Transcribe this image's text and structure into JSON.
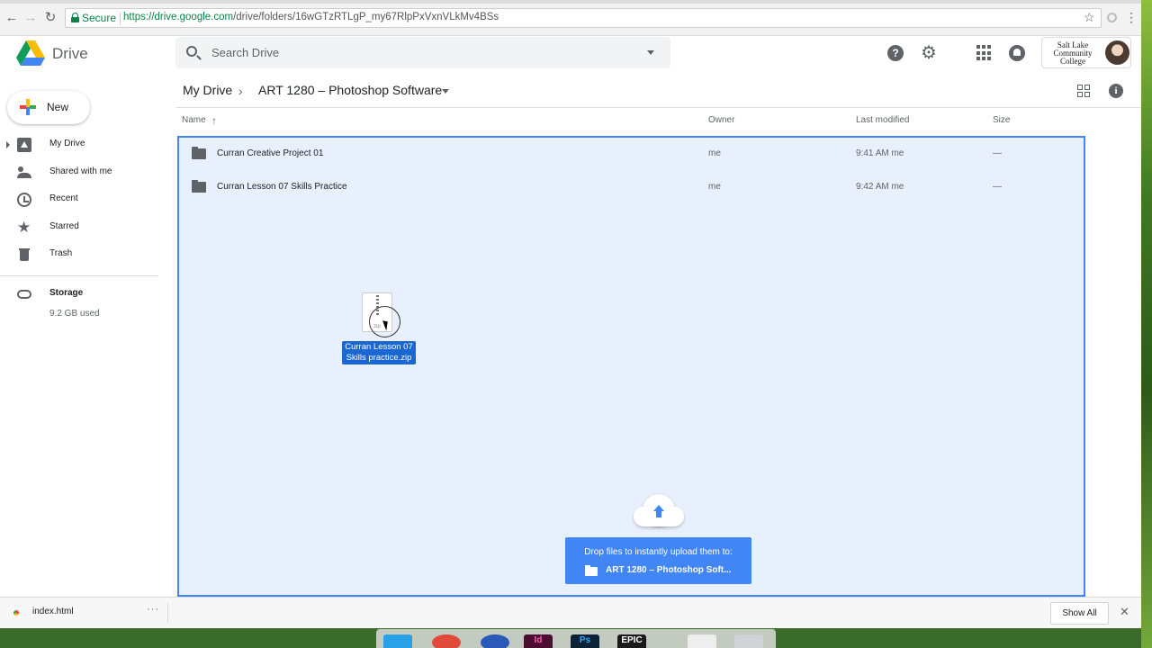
{
  "browser": {
    "secure_label": "Secure",
    "url_host": "https://drive.google.com",
    "url_path": "/drive/folders/16wGTzRTLgP_my67RlpPxVxnVLkMv4BSs"
  },
  "header": {
    "app_name": "Drive",
    "search_placeholder": "Search Drive",
    "account_org": "Salt Lake Community College"
  },
  "sidebar": {
    "new_label": "New",
    "items": [
      {
        "label": "My Drive",
        "icon": "my-drive-icon"
      },
      {
        "label": "Shared with me",
        "icon": "people-icon"
      },
      {
        "label": "Recent",
        "icon": "clock-icon"
      },
      {
        "label": "Starred",
        "icon": "star-icon"
      },
      {
        "label": "Trash",
        "icon": "trash-icon"
      }
    ],
    "storage_label": "Storage",
    "storage_used": "9.2 GB used"
  },
  "breadcrumb": {
    "root": "My Drive",
    "current": "ART 1280 – Photoshop Software"
  },
  "table": {
    "columns": [
      "Name",
      "Owner",
      "Last modified",
      "Size"
    ],
    "rows": [
      {
        "name": "Curran Creative Project 01",
        "owner": "me",
        "modified": "9:41 AM  me",
        "size": "—"
      },
      {
        "name": "Curran Lesson 07 Skills Practice",
        "owner": "me",
        "modified": "9:42 AM  me",
        "size": "—"
      }
    ]
  },
  "drag": {
    "file_label": "Curran Lesson 07 Skills practice.zip"
  },
  "upload": {
    "prompt": "Drop files to instantly upload them to:",
    "target": "ART 1280 – Photoshop Soft..."
  },
  "downloads": {
    "file_name": "index.html",
    "more": "···",
    "show_all": "Show All",
    "close": "✕"
  },
  "colors": {
    "accent": "#4285f4",
    "drop_bg": "#e8f0fe",
    "secure_green": "#0b8043"
  }
}
